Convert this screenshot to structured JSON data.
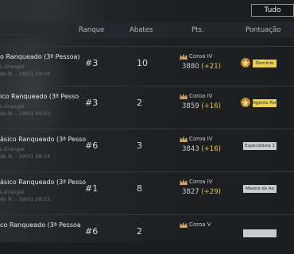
{
  "filter": {
    "label": "Tudo"
  },
  "header": {
    "rank": "Ranque",
    "kills": "Abates",
    "points": "Pts.",
    "score": "Pontuação",
    "faint": "• ---  -- ----"
  },
  "rows": [
    {
      "mode": "o Ranqueado (3ª Pessoa)",
      "map": "L-Erangel",
      "date": "do N. - 19/01 09:58",
      "rank": "#3",
      "kills": "10",
      "tier": "Coroa IV",
      "points": "3880",
      "delta": "(+21)",
      "badge": "Domínio",
      "badge_style": "gold"
    },
    {
      "mode": "ico Ranqueado (3ª Pesso",
      "map": "L-Erangel",
      "date": "do N. - 19/01 09:23",
      "rank": "#3",
      "kills": "2",
      "tier": "Coroa IV",
      "points": "3859",
      "delta": "(+16)",
      "badge": "Agente Fome",
      "badge_style": "gold"
    },
    {
      "mode": "ásico Ranqueado (3ª Pesso",
      "map": "L-Erangel",
      "date": "do N. - 19/01 08:54",
      "rank": "#6",
      "kills": "3",
      "tier": "Coroa IV",
      "points": "3843",
      "delta": "(+16)",
      "badge": "Especialista 1",
      "badge_style": "grey"
    },
    {
      "mode": "ásico Ranqueado (3ª Pesso",
      "map": "L-Erangel",
      "date": "do N. - 19/01 08:23",
      "rank": "#1",
      "kills": "8",
      "tier": "Coroa IV",
      "points": "3827",
      "delta": "(+29)",
      "badge": "Mestre do Ao",
      "badge_style": "grey"
    },
    {
      "mode": "co Ranqueado (3ª Pessoa",
      "map": "",
      "date": "",
      "rank": "#6",
      "kills": "2",
      "tier": "Coroa V",
      "points": "",
      "delta": "",
      "badge": "",
      "badge_style": "grey"
    }
  ],
  "colors": {
    "delta": "#e8c64a",
    "gold_badge": "#e9d24a",
    "grey_badge": "#c9cbce"
  },
  "icons": {
    "tier": "crown-tier-icon",
    "emblem": "achievement-emblem-icon"
  }
}
